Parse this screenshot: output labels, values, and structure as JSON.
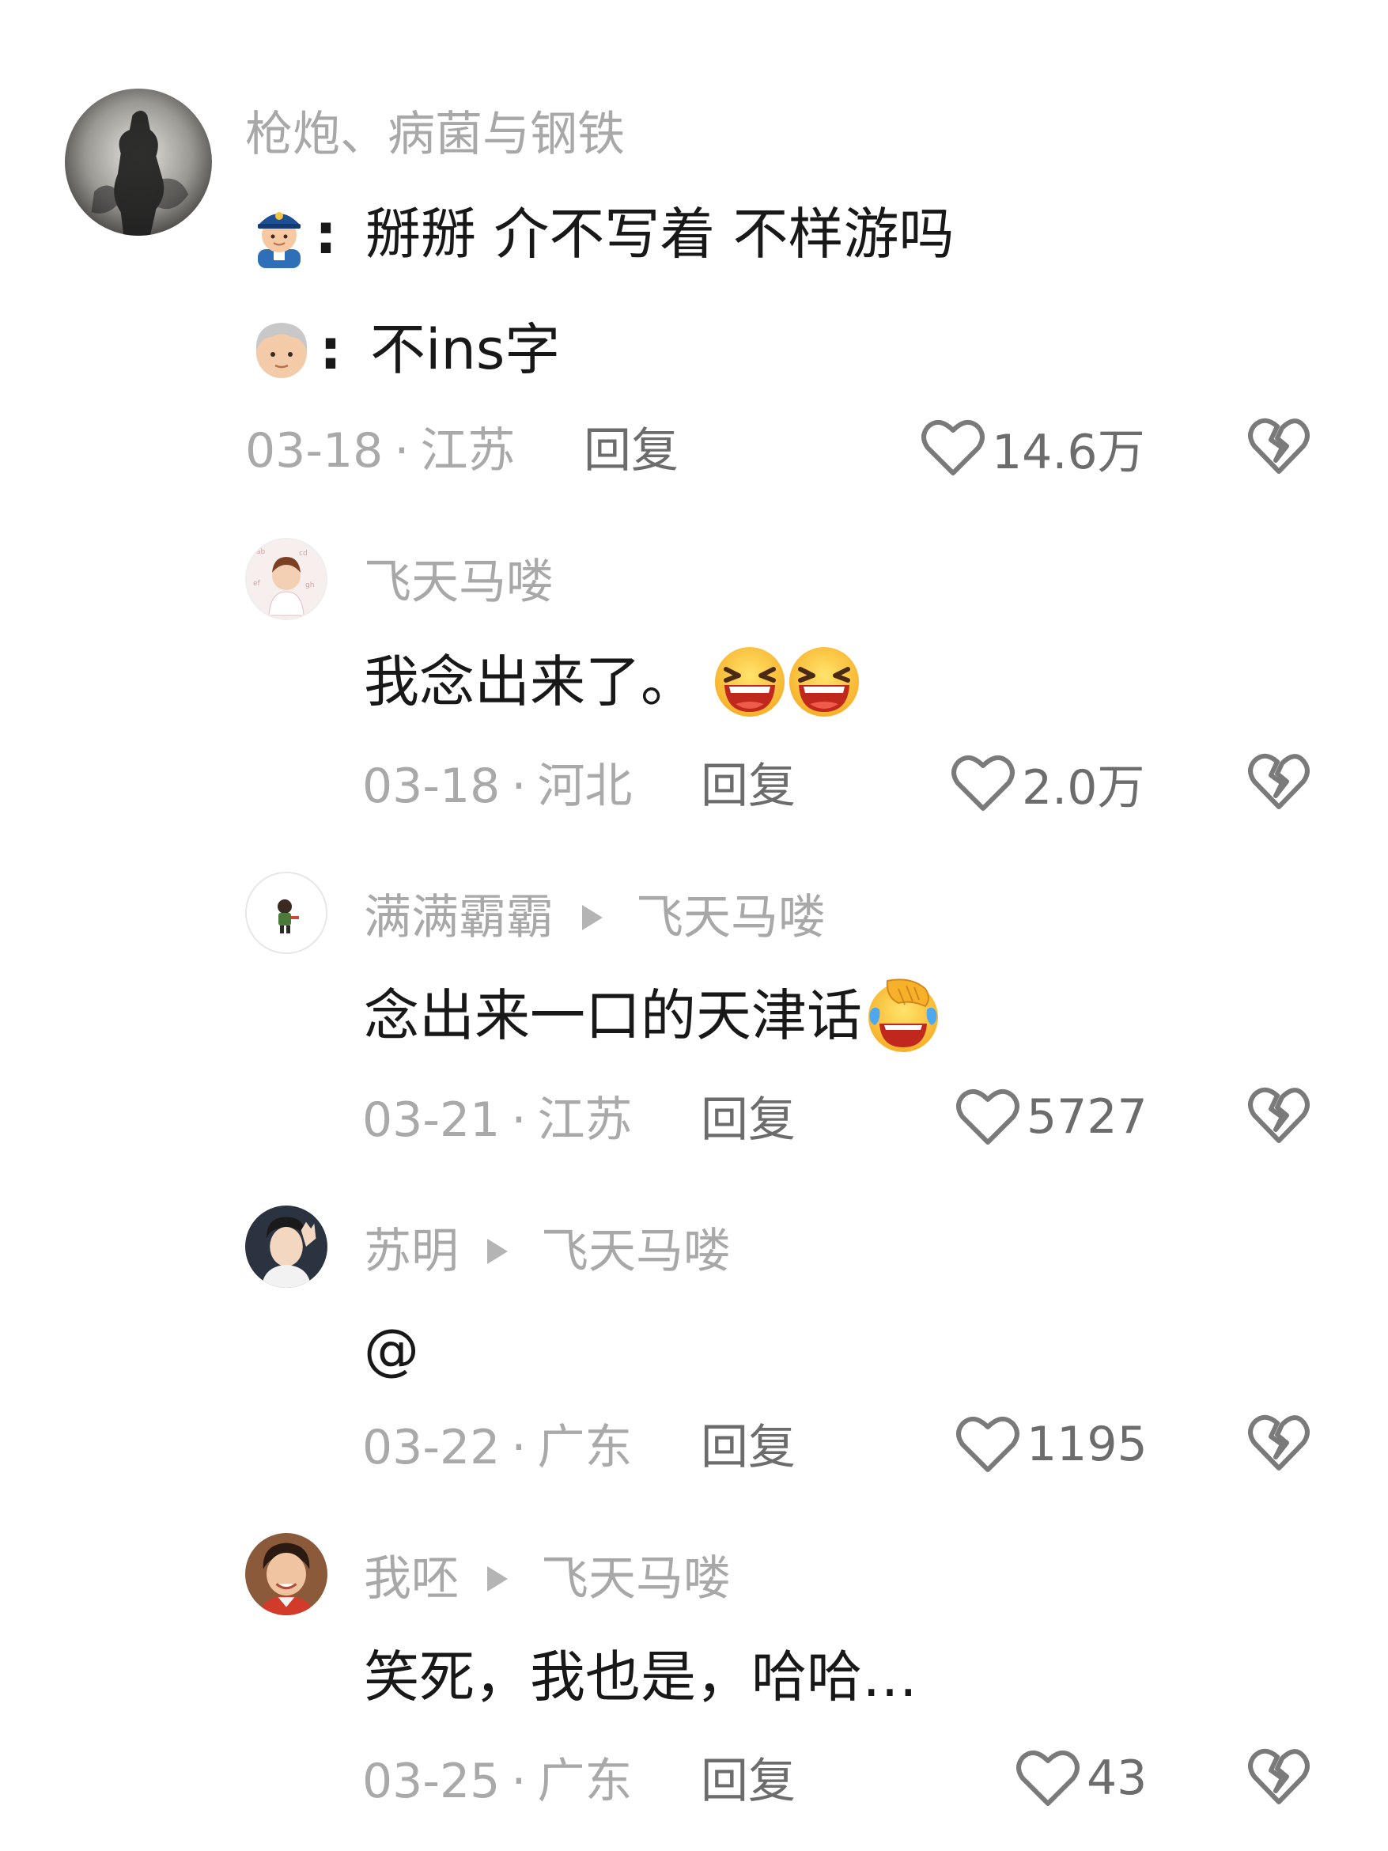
{
  "comments": [
    {
      "author": "枪炮、病菌与钢铁",
      "reply_to": "",
      "lines": [
        {
          "emoji": "police-officer-emoji",
          "text": "掰掰 介不写着 不样游吗"
        },
        {
          "emoji": "older-man-emoji",
          "text": "不ins字"
        }
      ],
      "date": "03-18",
      "location": "江苏",
      "reply_label": "回复",
      "likes": "14.6万"
    },
    {
      "author": "飞天马喽",
      "reply_to": "",
      "text": "我念出来了。",
      "trailing_emoji": [
        "grinning-squinting-emoji",
        "grinning-squinting-emoji"
      ],
      "date": "03-18",
      "location": "河北",
      "reply_label": "回复",
      "likes": "2.0万"
    },
    {
      "author": "满满霸霸",
      "reply_to": "飞天马喽",
      "text": "念出来一口的天津话",
      "trailing_emoji": [
        "face-palm-laughing-emoji"
      ],
      "date": "03-21",
      "location": "江苏",
      "reply_label": "回复",
      "likes": "5727"
    },
    {
      "author": "苏明",
      "reply_to": "飞天马喽",
      "text": "@",
      "date": "03-22",
      "location": "广东",
      "reply_label": "回复",
      "likes": "1195"
    },
    {
      "author": "我呸",
      "reply_to": "飞天马喽",
      "text": "笑死，我也是，哈哈…",
      "date": "03-25",
      "location": "广东",
      "reply_label": "回复",
      "likes": "43"
    }
  ],
  "meta_separator": "·",
  "icons": {
    "like": "heart-outline-icon",
    "dislike": "broken-heart-icon",
    "reply_arrow": "triangle-right-icon"
  },
  "colors": {
    "name_gray": "#a8a8a8",
    "action_gray": "#6c6c6c",
    "text": "#181818"
  }
}
